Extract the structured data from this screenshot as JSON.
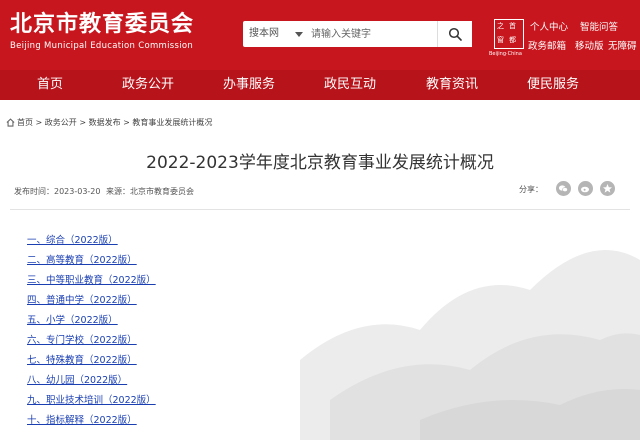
{
  "header": {
    "logo_cn": "北京市教育委员会",
    "logo_en": "Beijing Municipal Education Commission",
    "search_scope": "搜本网",
    "search_placeholder": "请输入关键字",
    "seal_text": [
      "之",
      "首",
      "窗",
      "都"
    ],
    "seal_sub": "Beijing·China",
    "links": [
      "个人中心",
      "智能问答",
      "政务邮箱",
      "移动版",
      "无障碍"
    ]
  },
  "nav": {
    "items": [
      "首页",
      "政务公开",
      "办事服务",
      "政民互动",
      "教育资讯",
      "便民服务"
    ]
  },
  "breadcrumb": [
    "首页",
    "政务公开",
    "数据发布",
    "教育事业发展统计概况"
  ],
  "breadcrumb_sep": ">",
  "article": {
    "title": "2022-2023学年度北京教育事业发展统计概况",
    "publish_time": "发布时间：2023-03-20",
    "source": "来源：北京市教育委员会",
    "share_label": "分享："
  },
  "list": [
    "一、综合（2022版）",
    "二、高等教育（2022版）",
    "三、中等职业教育（2022版）",
    "四、普通中学（2022版）",
    "五、小学（2022版）",
    "六、专门学校（2022版）",
    "七、特殊教育（2022版）",
    "八、幼儿园（2022版）",
    "九、职业技术培训（2022版）",
    "十、指标解释（2022版）"
  ],
  "colors": {
    "brand_red": "#c8161e",
    "nav_red": "#b7131a",
    "link_blue": "#1a3fb2"
  },
  "icons": [
    "search-icon",
    "home-icon",
    "wechat-icon",
    "weibo-icon",
    "qzone-icon"
  ]
}
